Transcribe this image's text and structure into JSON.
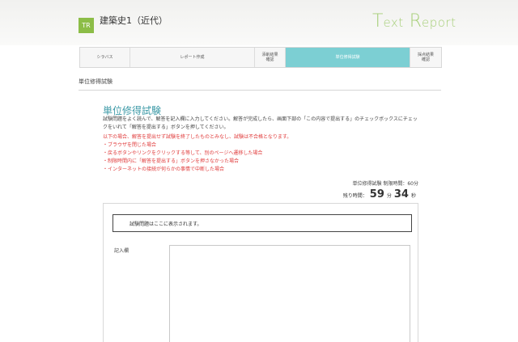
{
  "header": {
    "logo_text": "TR",
    "course_title": "建築史1（近代）",
    "brand_initial_1": "T",
    "brand_rest_1": "ext",
    "brand_initial_2": "R",
    "brand_rest_2": "eport"
  },
  "steps": [
    {
      "label": "シラバス",
      "active": false
    },
    {
      "label": "レポート作成",
      "active": false
    },
    {
      "label": "添削結果確認",
      "line1": "添削結果",
      "line2": "確認",
      "active": false
    },
    {
      "label": "単位修得試験",
      "active": true
    },
    {
      "label": "採点結果確認",
      "line1": "採点結果",
      "line2": "確認",
      "active": false
    }
  ],
  "breadcrumb": "単位修得試験",
  "exam": {
    "title": "単位修得試験",
    "intro": "試験問題をよく読んで、解答を記入欄に入力してください。解答が完成したら、画面下部の「この内容で提出する」のチェックボックスにチェックをいれて「解答を提出する」ボタンを押してください。",
    "warning_intro": "以下の場合、解答を提出せず試験を終了したものとみなし、試験は不合格となります。",
    "warnings": [
      "・ブラウザを閉じた場合",
      "・戻るボタンやリンクをクリックする等して、別のページへ遷移した場合",
      "・制限時間内に「解答を提出する」ボタンを押さなかった場合",
      "・インターネットの接続が何らかの事情で中断した場合"
    ],
    "time_limit": "単位修得試験 制限時間：60分",
    "remaining_label": "残り時間：",
    "remaining_minutes": "59",
    "minutes_unit": "分",
    "remaining_seconds": "34",
    "seconds_unit": "秒",
    "question_placeholder": "試験問題はここに表示されます。",
    "answer_label": "記入欄",
    "answer_value": ""
  },
  "colors": {
    "accent": "#7ccfd3",
    "title": "#3d9aa7",
    "warning": "#e03a3a",
    "logo": "#8cbd47"
  }
}
